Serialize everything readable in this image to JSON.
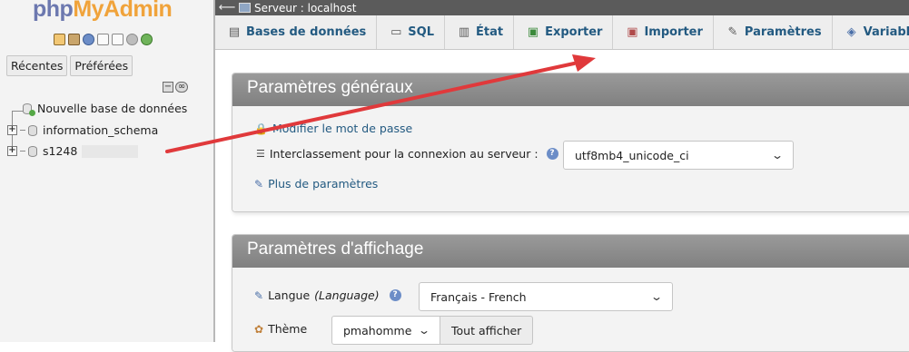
{
  "logo": {
    "php": "php",
    "rest": "MyAdmin"
  },
  "nav": {
    "icons": [
      "home-icon",
      "exit-icon",
      "help-icon",
      "docs-icon",
      "sql-docs-icon",
      "settings-icon",
      "reload-icon"
    ],
    "tabs": [
      "Récentes",
      "Préférées"
    ],
    "tree_tools": [
      "collapse-all-icon",
      "link-icon"
    ],
    "tree": [
      {
        "label": "Nouvelle base de données",
        "type": "new-db"
      },
      {
        "label": "information_schema",
        "type": "db"
      },
      {
        "label": "s1248",
        "type": "db",
        "redacted": true
      }
    ]
  },
  "breadcrumb": {
    "server": "Serveur : localhost"
  },
  "menu": [
    {
      "label": "Bases de données",
      "icon": "database-icon"
    },
    {
      "label": "SQL",
      "icon": "sql-icon"
    },
    {
      "label": "État",
      "icon": "status-icon"
    },
    {
      "label": "Exporter",
      "icon": "export-icon"
    },
    {
      "label": "Importer",
      "icon": "import-icon"
    },
    {
      "label": "Paramètres",
      "icon": "wrench-icon"
    },
    {
      "label": "Variables",
      "icon": "variables-icon"
    }
  ],
  "general": {
    "title": "Paramètres généraux",
    "change_password": "Modifier le mot de passe",
    "collation_label": "Interclassement pour la connexion au serveur :",
    "collation_value": "utf8mb4_unicode_ci",
    "more_settings": "Plus de paramètres"
  },
  "display": {
    "title": "Paramètres d'affichage",
    "language_label": "Langue",
    "language_label_en": "(Language)",
    "language_value": "Français - French",
    "theme_label": "Thème",
    "theme_value": "pmahomme",
    "show_all": "Tout afficher"
  },
  "annotation": {
    "color": "#e0393b"
  }
}
